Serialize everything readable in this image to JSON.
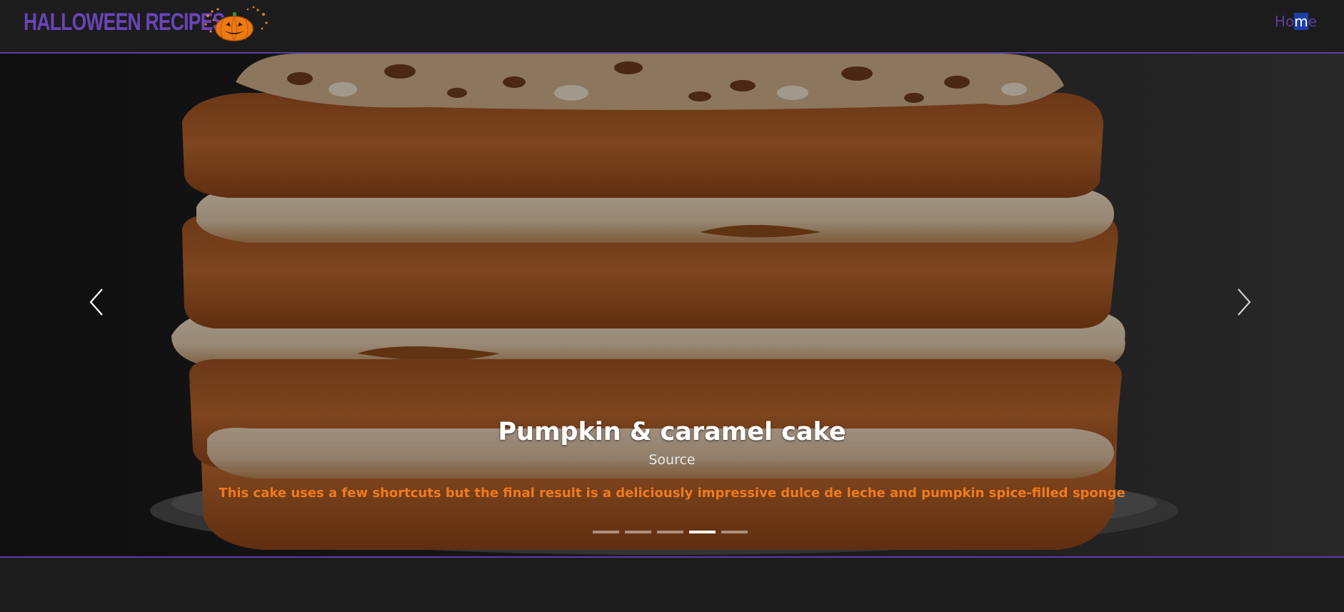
{
  "header": {
    "brand": "HALLOWEEN RECIPES",
    "nav": {
      "home_pre": "Ho",
      "home_sel": "m",
      "home_post": "e"
    }
  },
  "carousel": {
    "slide": {
      "title": "Pumpkin & caramel cake",
      "source_label": "Source",
      "description": "This cake uses a few shortcuts but the final result is a deliciously impressive dulce de leche and pumpkin spice-filled sponge"
    },
    "indicator_count": 5,
    "active_indicator": 4
  },
  "colors": {
    "brand": "#6a44b8",
    "accent_border": "#5b3fa0",
    "description": "#f07a1c",
    "background": "#1c1c1c"
  },
  "icons": {
    "logo": "pumpkin-icon",
    "prev": "chevron-left-icon",
    "next": "chevron-right-icon"
  }
}
